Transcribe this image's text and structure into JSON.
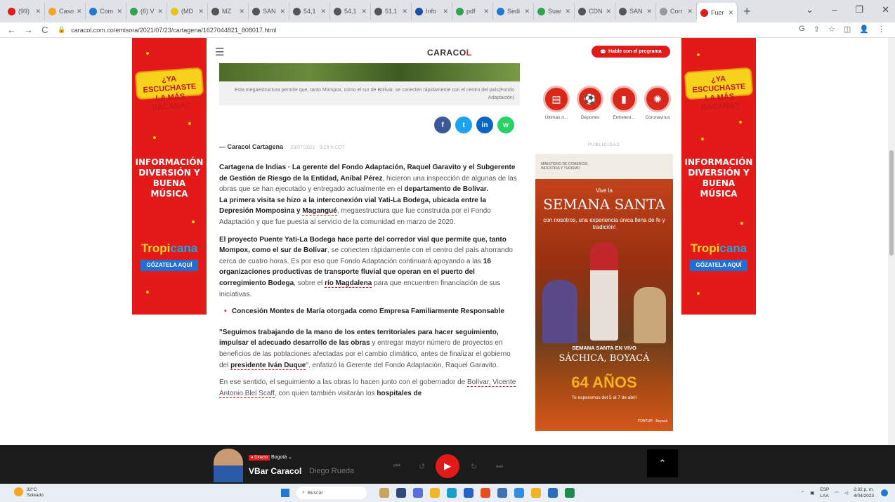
{
  "browser": {
    "tabs": [
      {
        "label": "(99)",
        "color": "#e21a1a"
      },
      {
        "label": "Caso",
        "color": "#f5a623"
      },
      {
        "label": "Com",
        "color": "#1f78d1"
      },
      {
        "label": "(6) V",
        "color": "#2ea44f"
      },
      {
        "label": "(MD",
        "color": "#e8c215"
      },
      {
        "label": "MZ",
        "color": "#555555"
      },
      {
        "label": "SAN",
        "color": "#555555"
      },
      {
        "label": "54,1",
        "color": "#555555"
      },
      {
        "label": "54,1",
        "color": "#555555"
      },
      {
        "label": "51,1",
        "color": "#555555"
      },
      {
        "label": "Info",
        "color": "#1f4ea8"
      },
      {
        "label": "pdf",
        "color": "#2ea44f"
      },
      {
        "label": "Sedi",
        "color": "#1f78d1"
      },
      {
        "label": "Suar",
        "color": "#2ea44f"
      },
      {
        "label": "CDN",
        "color": "#555555"
      },
      {
        "label": "SAN",
        "color": "#555555"
      },
      {
        "label": "Corr",
        "color": "#999999"
      },
      {
        "label": "Fuer",
        "color": "#e21a1a"
      }
    ],
    "new_tab": "+",
    "url": "caracol.com.co/emisora/2021/07/23/cartagena/1627044821_808017.html"
  },
  "site": {
    "logo_prefix": "CARACO",
    "logo_suffix": "L",
    "live_button": "Hable con el programa"
  },
  "article": {
    "caption": "Esta megaestructura permite que, tanto Mompox, como el sur de Bolívar, se conecten rápidamente con el centro del país(Fondo Adaptación)",
    "byline": "— Caracol Cartagena",
    "date": "23/07/2021 - 9:16 h COT",
    "p1_a": "Cartagena de Indias · La gerente del Fondo Adaptación, Raquel Garavito y el Subgerente de Gestión de Riesgo de la Entidad, Aníbal Pérez",
    "p1_b": ", hicieron una inspección de algunas de las obras que se han ejecutado y entregado actualmente en el ",
    "p1_c": "departamento de Bolívar.",
    "p2_a": "La primera visita se hizo a la interconexión vial Yati-La Bodega, ubicada entre la Depresión Momposina y ",
    "p2_b": "Magangué",
    "p2_c": ", megaestructura que fue construida por el Fondo Adaptación y que fue puesta al servicio de la comunidad en marzo de 2020.",
    "p3_a": "El proyecto Puente Yati-La Bodega hace parte del corredor vial que permite que, tanto Mompox, como el sur de Bolívar",
    "p3_b": ", se conecten rápidamente con el centro del país ahorrando cerca de cuatro horas. Es por eso que Fondo Adaptación continuará apoyando a las ",
    "p3_c": "16 organizaciones productivas de transporte fluvial que operan en el puerto del corregimiento Bodega",
    "p3_d": ", sobre el ",
    "p3_e": "río Magdalena",
    "p3_f": " para que encuentren financiación de sus iniciativas.",
    "bullet": "Concesión Montes de María otorgada como Empresa Familiarmente Responsable",
    "p4_a": "\"Seguimos trabajando de la mano de los entes territoriales para hacer seguimiento, impulsar el adecuado desarrollo de las obras",
    "p4_b": " y entregar mayor número de proyectos en beneficios de las poblaciones afectadas por el cambio climático, antes de finalizar el gobierno del ",
    "p4_c": "presidente Iván Duque",
    "p4_d": "\", enfatizó la Gerente del Fondo Adaptación, Raquel Garavito.",
    "p5_a": "En ese sentido, el seguimiento a las obras lo hacen junto con el gobernador de ",
    "p5_b": "Bolívar, Vicente Antonio Blel Scaff",
    "p5_c": ", con quien también visitarán los ",
    "p5_d": "hospitales de"
  },
  "categories": [
    {
      "label": "Últimas n...",
      "icon": "▤"
    },
    {
      "label": "Deportes",
      "icon": "⚽"
    },
    {
      "label": "Entreteni...",
      "icon": "▮"
    },
    {
      "label": "Coronavirus",
      "icon": "✺"
    }
  ],
  "ads": {
    "publicidad": "PUBLICIDAD",
    "banner": {
      "question": "¿YA ESCUCHASTE LA MÁS BACANA?",
      "info": "INFORMACIÓN DIVERSIÓN Y BUENA MÚSICA",
      "brand_a": "Tropi",
      "brand_b": "cana",
      "cta": "GÓZATELA AQUÍ"
    },
    "semana": {
      "ministry": "MINISTERIO DE COMERCIO, INDUSTRIA Y TURISMO",
      "from": "Vive la",
      "title": "SEMANA SANTA",
      "sub": "con nosotros, una experiencia única llena de fe y tradición!",
      "vivo": "SEMANA SANTA EN VIVO",
      "place": "SÁCHICA, BOYACÁ",
      "years": "64 AÑOS",
      "dates": "Te esperamos del 5 al 7 de abril",
      "footer": "FONTUR · Boyacá"
    }
  },
  "player": {
    "live_tag": "● Directo",
    "city": "Bogotá ⌄",
    "show": "VBar Caracol",
    "host": "Diego Rueda"
  },
  "taskbar": {
    "temp": "32°C",
    "weather": "Soleado",
    "search": "Buscar",
    "lang": "ESP",
    "region": "LAA",
    "time": "2:32 p. m.",
    "date": "4/04/2023"
  }
}
